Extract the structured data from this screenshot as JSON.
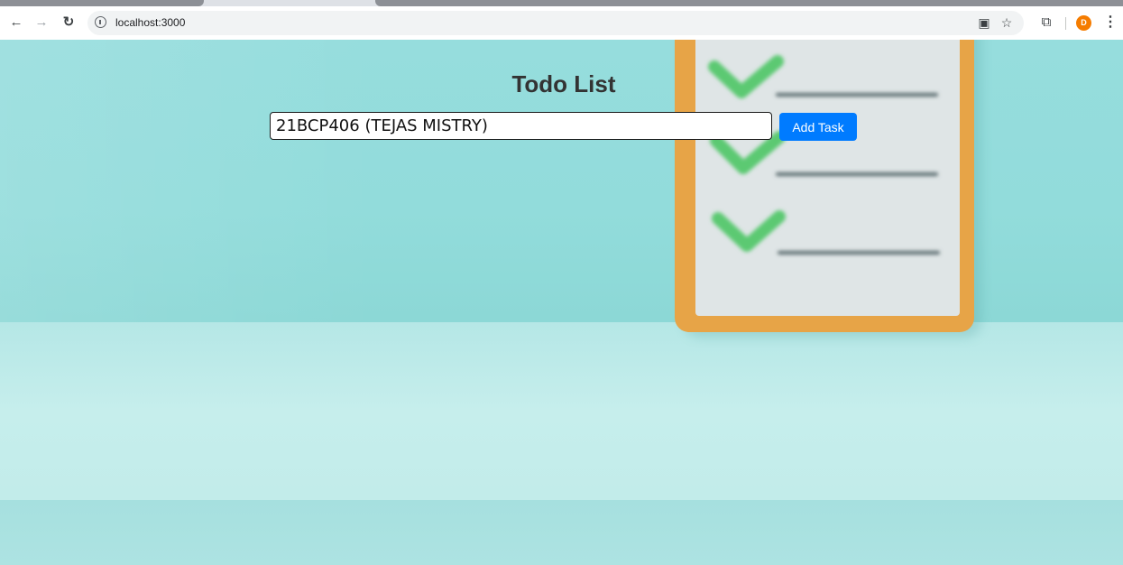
{
  "browser": {
    "url": "localhost:3000",
    "avatar_letter": "D",
    "icons": {
      "back": "arrow-left-icon",
      "forward": "arrow-right-icon",
      "reload": "reload-icon",
      "site_info": "info-icon",
      "install": "install-app-icon",
      "bookmark": "star-icon",
      "extensions": "puzzle-icon",
      "menu": "kebab-menu-icon"
    }
  },
  "app": {
    "title": "Todo List",
    "task_input_value": "21BCP406 (TEJAS MISTRY)",
    "add_button_label": "Add Task"
  },
  "colors": {
    "accent": "#007bff",
    "background": "#92dcdb",
    "checkmark": "#5cc972",
    "clipboard_frame": "#e7a447"
  }
}
